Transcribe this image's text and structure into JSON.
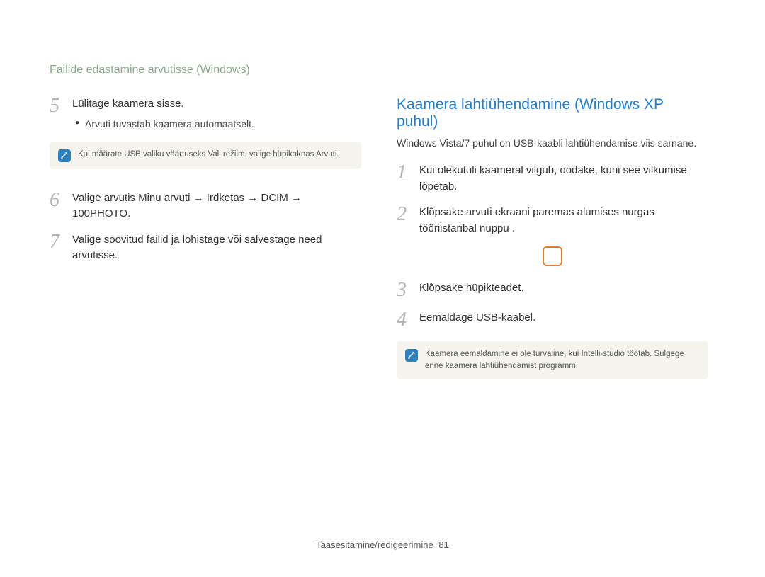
{
  "breadcrumb": "Failide edastamine arvutisse (Windows)",
  "left": {
    "step5": {
      "num": "5",
      "title": "Lülitage kaamera sisse.",
      "bullet": "Arvuti tuvastab kaamera automaatselt.",
      "note": "Kui määrate USB valiku väärtuseks Vali režiim, valige hüpikaknas Arvuti."
    },
    "step6": {
      "num": "6",
      "text_prefix": "Valige arvutis ",
      "path": "Minu arvuti → Irdketas → DCIM → 100PHOTO",
      "suffix": "."
    },
    "step7": {
      "num": "7",
      "text": "Valige soovitud failid ja lohistage või salvestage need arvutisse."
    }
  },
  "right": {
    "heading": "Kaamera lahtiühendamine (Windows XP puhul)",
    "intro": "Windows Vista/7 puhul on USB-kaabli lahtiühendamise viis sarnane.",
    "step1": {
      "num": "1",
      "text": "Kui olekutuli kaameral vilgub, oodake, kuni see vilkumise lõpetab."
    },
    "step2": {
      "num": "2",
      "text": "Klõpsake arvuti ekraani paremas alumises nurgas tööriistaribal nuppu       ."
    },
    "step3": {
      "num": "3",
      "text": "Klõpsake hüpikteadet."
    },
    "step4": {
      "num": "4",
      "text": "Eemaldage USB-kaabel."
    },
    "note": "Kaamera eemaldamine ei ole turvaline, kui Intelli-studio töötab. Sulgege enne kaamera lahtiühendamist programm."
  },
  "footer": {
    "section": "Taasesitamine/redigeerimine",
    "page": "81"
  }
}
